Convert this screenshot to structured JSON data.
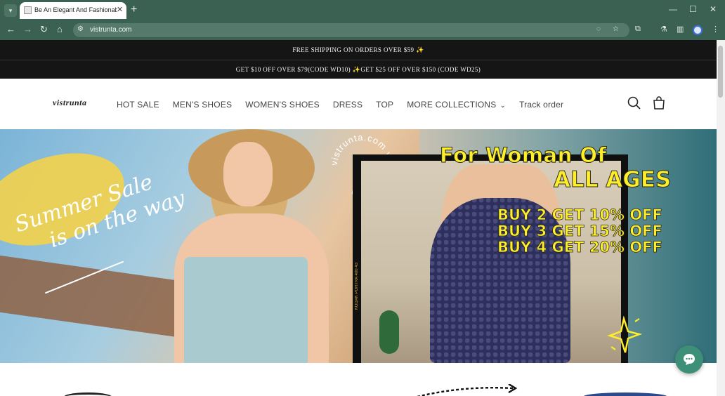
{
  "browser": {
    "tab_title": "Be An Elegant And Fashionable",
    "url": "vistrunta.com"
  },
  "announcements": [
    "FREE SHIPPING ON ORDERS OVER $59 ✨",
    "GET $10 OFF OVER $79(CODE WD10) ✨GET $25 OFF OVER $150 (CODE WD25)"
  ],
  "header": {
    "logo": "vistrunta",
    "nav": [
      "HOT SALE",
      "MEN'S SHOES",
      "WOMEN'S SHOES",
      "DRESS",
      "TOP",
      "MORE COLLECTIONS",
      "Track order"
    ]
  },
  "hero": {
    "sale_line_1": "Summer Sale",
    "sale_line_2": "is on the way",
    "circle_text": "vistrunta.com vistrunta.com",
    "promo_line_1": "For Woman Of",
    "promo_line_2": "ALL AGES",
    "offers": [
      "BUY 2 GET 10% OFF",
      "BUY 3 GET 15% OFF",
      "BUY 4 GET 20% OFF"
    ],
    "film_text": "KODAK PORTRA 400  43"
  },
  "colors": {
    "browser_chrome": "#3b6152",
    "announcement_bg": "#151515",
    "promo_yellow": "#ffef2a",
    "chat_button": "#3d8f78"
  }
}
